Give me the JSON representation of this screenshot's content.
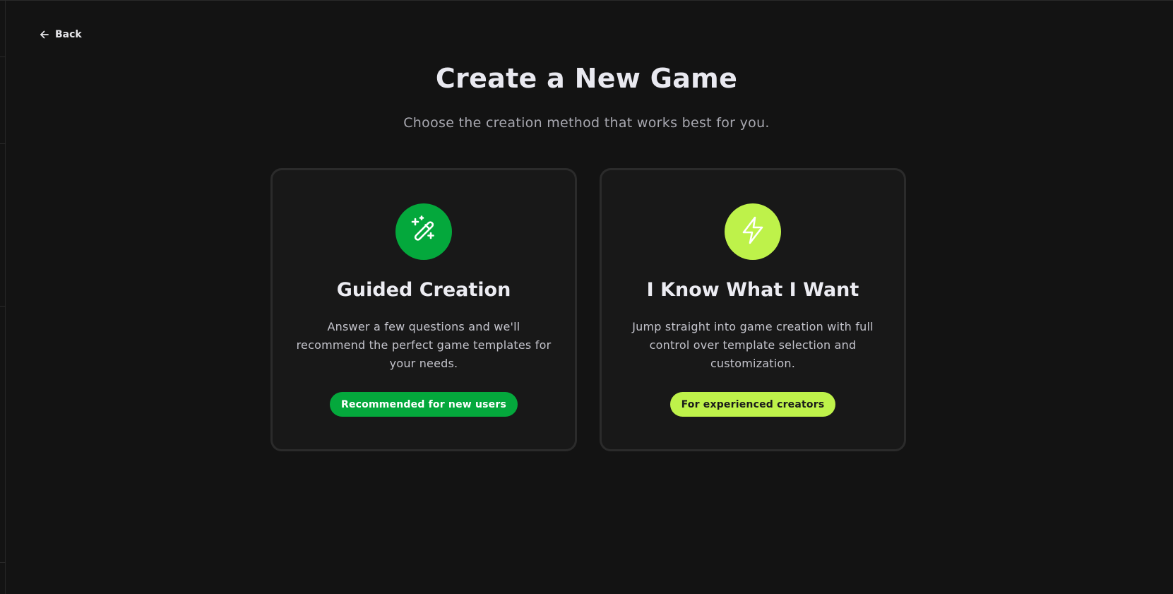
{
  "nav": {
    "back_label": "Back",
    "back_icon": "arrow-left-icon"
  },
  "header": {
    "title": "Create a New Game",
    "subtitle": "Choose the creation method that works best for you."
  },
  "options": [
    {
      "icon": "magic-wand-icon",
      "title": "Guided Creation",
      "description": "Answer a few questions and we'll recommend the perfect game templates for your needs.",
      "badge": "Recommended for new users",
      "accent": "#04a83c"
    },
    {
      "icon": "lightning-bolt-icon",
      "title": "I Know What I Want",
      "description": "Jump straight into game creation with full control over template selection and customization.",
      "badge": "For experienced creators",
      "accent": "#bef24a"
    }
  ],
  "colors": {
    "background": "#131313",
    "card_background": "#181818",
    "card_border": "#2b2b2b"
  }
}
